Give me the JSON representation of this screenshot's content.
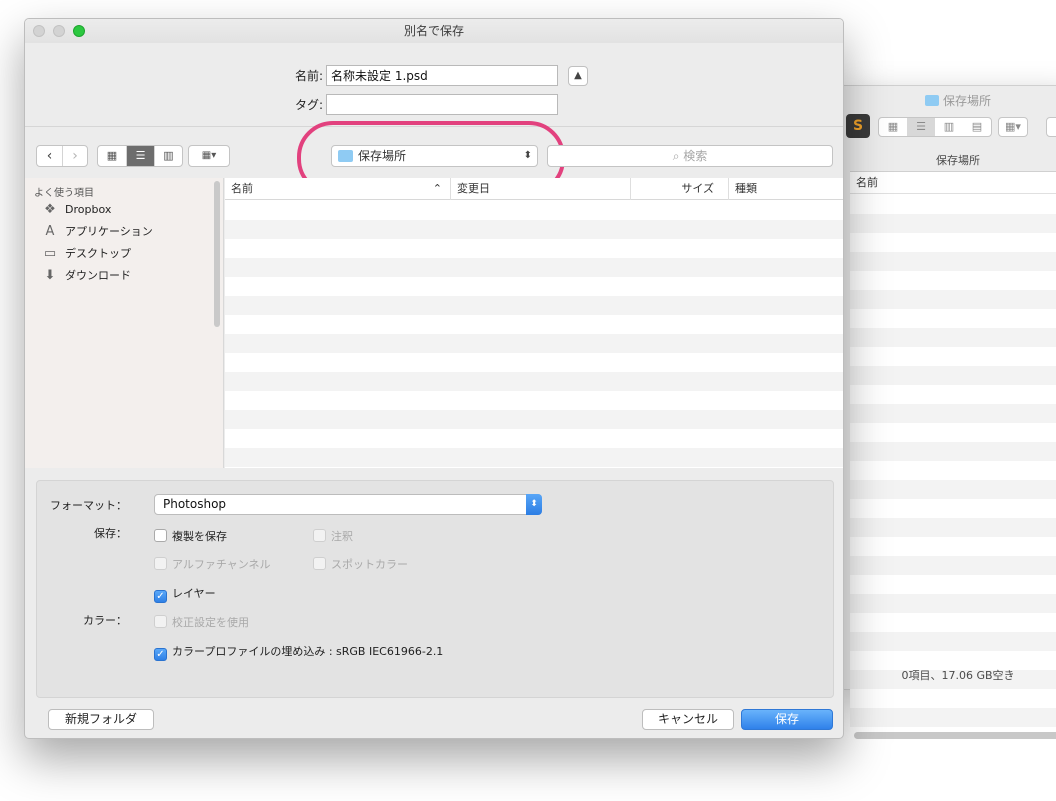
{
  "background_window": {
    "title": "保存場所",
    "app_icon_letter": "S",
    "location_label": "保存場所",
    "column_name": "名前",
    "status": "0項目、17.06 GB空き"
  },
  "dialog": {
    "title": "別名で保存",
    "name_label": "名前:",
    "name_value": "名称未設定 1.psd",
    "tag_label": "タグ:",
    "tag_value": "",
    "location": "保存場所",
    "search_placeholder": "検索",
    "search_icon_glyph": "⌕",
    "highlight_color": "#e2417e"
  },
  "sidebar": {
    "heading": "よく使う項目",
    "items": [
      {
        "label": "Dropbox",
        "icon": "dropbox-icon"
      },
      {
        "label": "アプリケーション",
        "icon": "applications-icon"
      },
      {
        "label": "デスクトップ",
        "icon": "desktop-icon"
      },
      {
        "label": "ダウンロード",
        "icon": "downloads-icon"
      }
    ]
  },
  "file_list": {
    "columns": [
      "名前",
      "変更日",
      "サイズ",
      "種類"
    ]
  },
  "options": {
    "format_label": "フォーマット：",
    "format_value": "Photoshop",
    "save_label": "保存：",
    "color_label": "カラー：",
    "checkboxes": {
      "copy": {
        "label": "複製を保存",
        "checked": false,
        "enabled": true
      },
      "notes": {
        "label": "注釈",
        "checked": false,
        "enabled": false
      },
      "alpha": {
        "label": "アルファチャンネル",
        "checked": false,
        "enabled": false
      },
      "spot": {
        "label": "スポットカラー",
        "checked": false,
        "enabled": false
      },
      "layers": {
        "label": "レイヤー",
        "checked": true,
        "enabled": true
      },
      "proof": {
        "label": "校正設定を使用",
        "checked": false,
        "enabled": false
      },
      "icc": {
        "label": "カラープロファイルの埋め込み : sRGB IEC61966-2.1",
        "checked": true,
        "enabled": true
      }
    }
  },
  "buttons": {
    "new_folder": "新規フォルダ",
    "cancel": "キャンセル",
    "save": "保存"
  },
  "colors": {
    "accent": "#2f81ea",
    "zoom_button": "#2cc840"
  }
}
